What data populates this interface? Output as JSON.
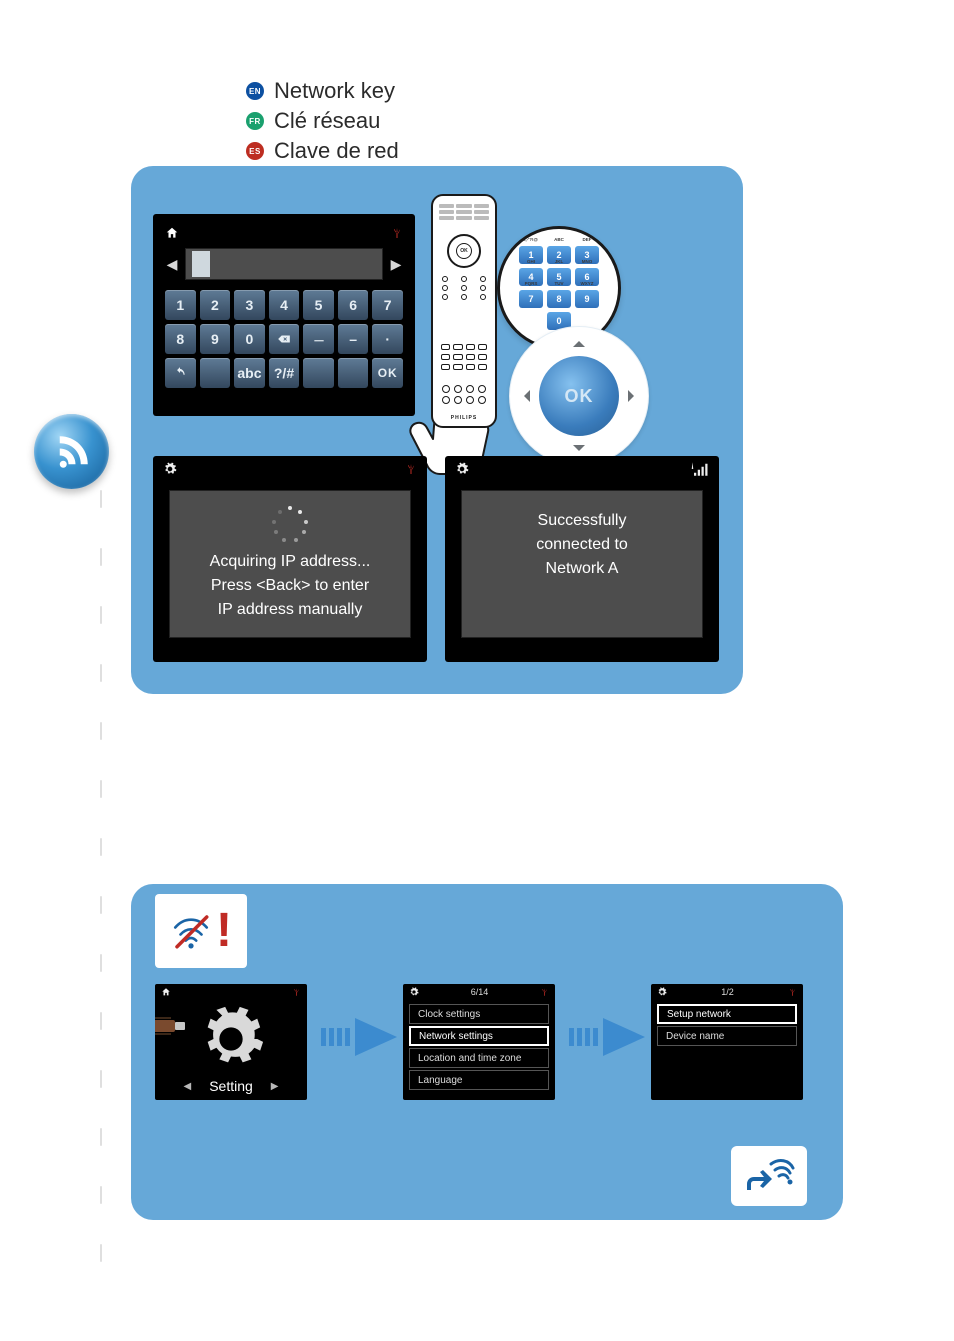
{
  "callout": {
    "en_code": "EN",
    "fr_code": "FR",
    "es_code": "ES",
    "en_text": "Network key",
    "fr_text": "Clé réseau",
    "es_text": "Clave de red"
  },
  "colors": {
    "panel_blue": "#66a8d8",
    "key_blue": "#4a6d8f",
    "accent_red": "#c02b25",
    "dark_grey": "#4d4d4d"
  },
  "keypad": {
    "row1": [
      "1",
      "2",
      "3",
      "4",
      "5",
      "6",
      "7"
    ],
    "row2": [
      "8",
      "9",
      "0"
    ],
    "abc_label": "abc",
    "sym_label": "?/#",
    "ok_label": "OK"
  },
  "remote": {
    "brand": "PHILIPS",
    "ok_label": "OK",
    "zoom_labels": {
      "1": {
        "num": "1",
        "sub": ".,-'?!@"
      },
      "2": {
        "num": "2",
        "sub": "ABC"
      },
      "3": {
        "num": "3",
        "sub": "DEF"
      },
      "4": {
        "num": "4",
        "sub": "GHI"
      },
      "5": {
        "num": "5",
        "sub": "JKL"
      },
      "6": {
        "num": "6",
        "sub": "MNO"
      },
      "7": {
        "num": "7",
        "sub": "PQRS"
      },
      "8": {
        "num": "8",
        "sub": "TUV"
      },
      "9": {
        "num": "9",
        "sub": "WXYZ"
      },
      "0": {
        "num": "0",
        "sub": ""
      }
    },
    "nav_ok_label": "OK"
  },
  "acquiring_screen": {
    "line1": "Acquiring IP address...",
    "line2": "Press <Back> to enter",
    "line3": "IP address manually"
  },
  "success_screen": {
    "line1": "Successfully",
    "line2": "connected to",
    "line3": "Network A"
  },
  "lower_panel": {
    "warn_bang": "!",
    "setting_label": "Setting",
    "menu1": {
      "counter": "6/14",
      "items": [
        "Clock settings",
        "Network settings",
        "Location and time zone",
        "Language"
      ],
      "selected_index": 1
    },
    "menu2": {
      "counter": "1/2",
      "items": [
        "Setup network",
        "Device name"
      ],
      "selected_index": 0
    }
  }
}
